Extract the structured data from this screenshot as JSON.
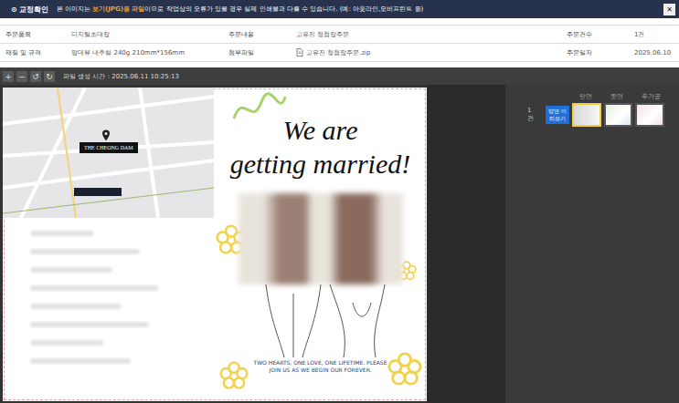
{
  "notice": {
    "icon": "⊙",
    "title": "교정확인",
    "prefix": "본 이미지는 ",
    "highlight": "보기(JPG)용 파일",
    "suffix": "이므로 작업상의 오류가 있을 경우 실제 인쇄물과 다를 수 있습니다. (예: 아웃라인,오버프린트 등)",
    "close": "✕"
  },
  "order_info": {
    "rows": [
      [
        {
          "label": "주문품목",
          "value": "디지털초대장"
        },
        {
          "label": "주문내용",
          "value": "고유진 청첩장주문"
        },
        {
          "label": "주문건수",
          "value": "1건"
        }
      ],
      [
        {
          "label": "재질 및 규격",
          "value": "랑데뷰 내추럴 240g 210mm*156mm"
        },
        {
          "label": "첨부파일",
          "value": "고유진 청첩장주문.zip",
          "attachment": true
        },
        {
          "label": "주문일자",
          "value": "2025.06.10"
        }
      ]
    ]
  },
  "toolbar": {
    "buttons": [
      "+",
      "−",
      "↺",
      "↻"
    ],
    "file_time": "파일 생성 시간 : 2025.06.11 10:25:13"
  },
  "proof": {
    "map_label": "THE CHEONG DAM",
    "title_lines": [
      "We are",
      "getting married!"
    ],
    "tagline": "TWO HEARTS, ONE LOVE, ONE LIFETIME. PLEASE JOIN US AS WE BEGIN OUR FOREVER."
  },
  "pages": {
    "columns": [
      "앞면",
      "뒷면",
      "후가공"
    ],
    "count": "1건",
    "preview_button": "양면 미리보기",
    "thumbnails": [
      {
        "selected": true
      },
      {
        "selected": false
      },
      {
        "selected": false
      }
    ]
  }
}
